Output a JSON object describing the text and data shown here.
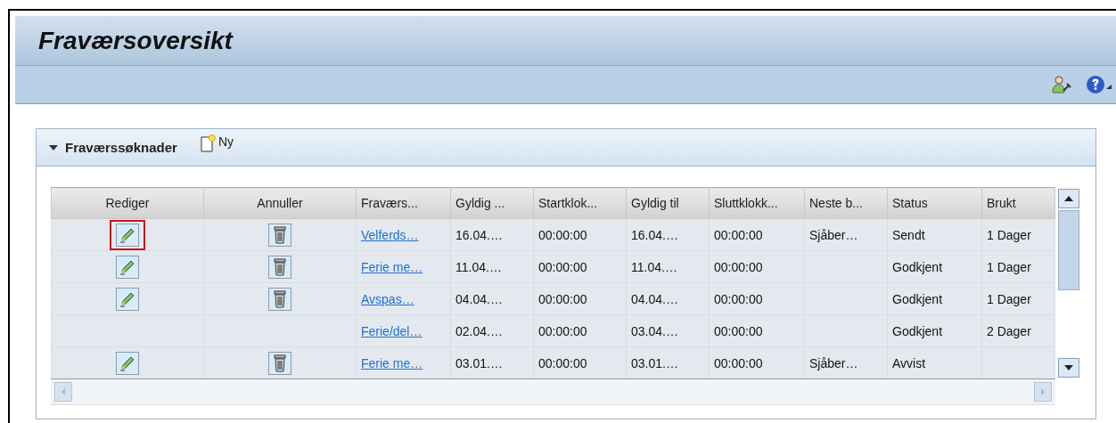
{
  "page": {
    "title": "Fraværsoversikt"
  },
  "panel": {
    "title": "Fraværssøknader",
    "expanded": true,
    "new_button": "Ny"
  },
  "table": {
    "columns": [
      "Rediger",
      "Annuller",
      "Fraværs...",
      "Gyldig ...",
      "Startklok...",
      "Gyldig til",
      "Sluttklokk...",
      "Neste b...",
      "Status",
      "Brukt"
    ],
    "rows": [
      {
        "editable": true,
        "highlighted": true,
        "cancellable": true,
        "cells": [
          "",
          "",
          "Velferds…",
          "16.04.…",
          "00:00:00",
          "16.04.…",
          "00:00:00",
          "Sjåber…",
          "Sendt",
          "1 Dager"
        ]
      },
      {
        "editable": true,
        "highlighted": false,
        "cancellable": true,
        "cells": [
          "",
          "",
          "Ferie me…",
          "11.04.…",
          "00:00:00",
          "11.04.…",
          "00:00:00",
          "",
          "Godkjent",
          "1 Dager"
        ]
      },
      {
        "editable": true,
        "highlighted": false,
        "cancellable": true,
        "cells": [
          "",
          "",
          "Avspas…",
          "04.04.…",
          "00:00:00",
          "04.04.…",
          "00:00:00",
          "",
          "Godkjent",
          "1 Dager"
        ]
      },
      {
        "editable": false,
        "highlighted": false,
        "cancellable": false,
        "cells": [
          "",
          "",
          "Ferie/del…",
          "02.04.…",
          "00:00:00",
          "03.04.…",
          "00:00:00",
          "",
          "Godkjent",
          "2 Dager"
        ]
      },
      {
        "editable": true,
        "highlighted": false,
        "cancellable": true,
        "cells": [
          "",
          "",
          "Ferie me…",
          "03.01.…",
          "00:00:00",
          "03.01.…",
          "00:00:00",
          "Sjåber…",
          "Avvist",
          ""
        ]
      }
    ]
  }
}
